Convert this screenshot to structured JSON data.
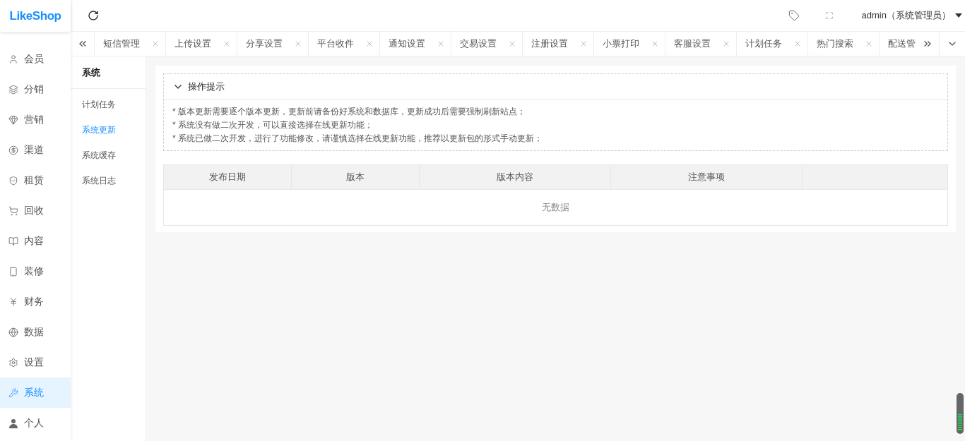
{
  "logo": "LikeShop",
  "header": {
    "user": "admin（系统管理员）"
  },
  "sidebar": {
    "items": [
      {
        "label": "会员",
        "selected": false
      },
      {
        "label": "分销",
        "selected": false
      },
      {
        "label": "营销",
        "selected": false
      },
      {
        "label": "渠道",
        "selected": false
      },
      {
        "label": "租赁",
        "selected": false
      },
      {
        "label": "回收",
        "selected": false
      },
      {
        "label": "内容",
        "selected": false
      },
      {
        "label": "装修",
        "selected": false
      },
      {
        "label": "财务",
        "selected": false
      },
      {
        "label": "数据",
        "selected": false
      },
      {
        "label": "设置",
        "selected": false
      },
      {
        "label": "系统",
        "selected": true
      },
      {
        "label": "个人",
        "selected": false
      }
    ]
  },
  "tabs": [
    {
      "label": "短信管理",
      "selected": false
    },
    {
      "label": "上传设置",
      "selected": false
    },
    {
      "label": "分享设置",
      "selected": false
    },
    {
      "label": "平台收件",
      "selected": false
    },
    {
      "label": "通知设置",
      "selected": false
    },
    {
      "label": "交易设置",
      "selected": false
    },
    {
      "label": "注册设置",
      "selected": false
    },
    {
      "label": "小票打印",
      "selected": false
    },
    {
      "label": "客服设置",
      "selected": false
    },
    {
      "label": "计划任务",
      "selected": false
    },
    {
      "label": "热门搜索",
      "selected": false
    },
    {
      "label": "配送管",
      "selected": false
    }
  ],
  "submenu": {
    "title": "系统",
    "items": [
      {
        "label": "计划任务",
        "selected": false
      },
      {
        "label": "系统更新",
        "selected": true
      },
      {
        "label": "系统缓存",
        "selected": false
      },
      {
        "label": "系统日志",
        "selected": false
      }
    ]
  },
  "tips": {
    "title": "操作提示",
    "expanded": true,
    "lines": [
      "* 版本更新需要逐个版本更新，更新前请备份好系统和数据库，更新成功后需要强制刷新站点；",
      "* 系统没有做二次开发，可以直接选择在线更新功能；",
      "* 系统已做二次开发，进行了功能修改，请谨慎选择在线更新功能，推荐以更新包的形式手动更新；"
    ]
  },
  "table": {
    "columns": [
      "发布日期",
      "版本",
      "版本内容",
      "注意事项"
    ],
    "empty": "无数据"
  }
}
